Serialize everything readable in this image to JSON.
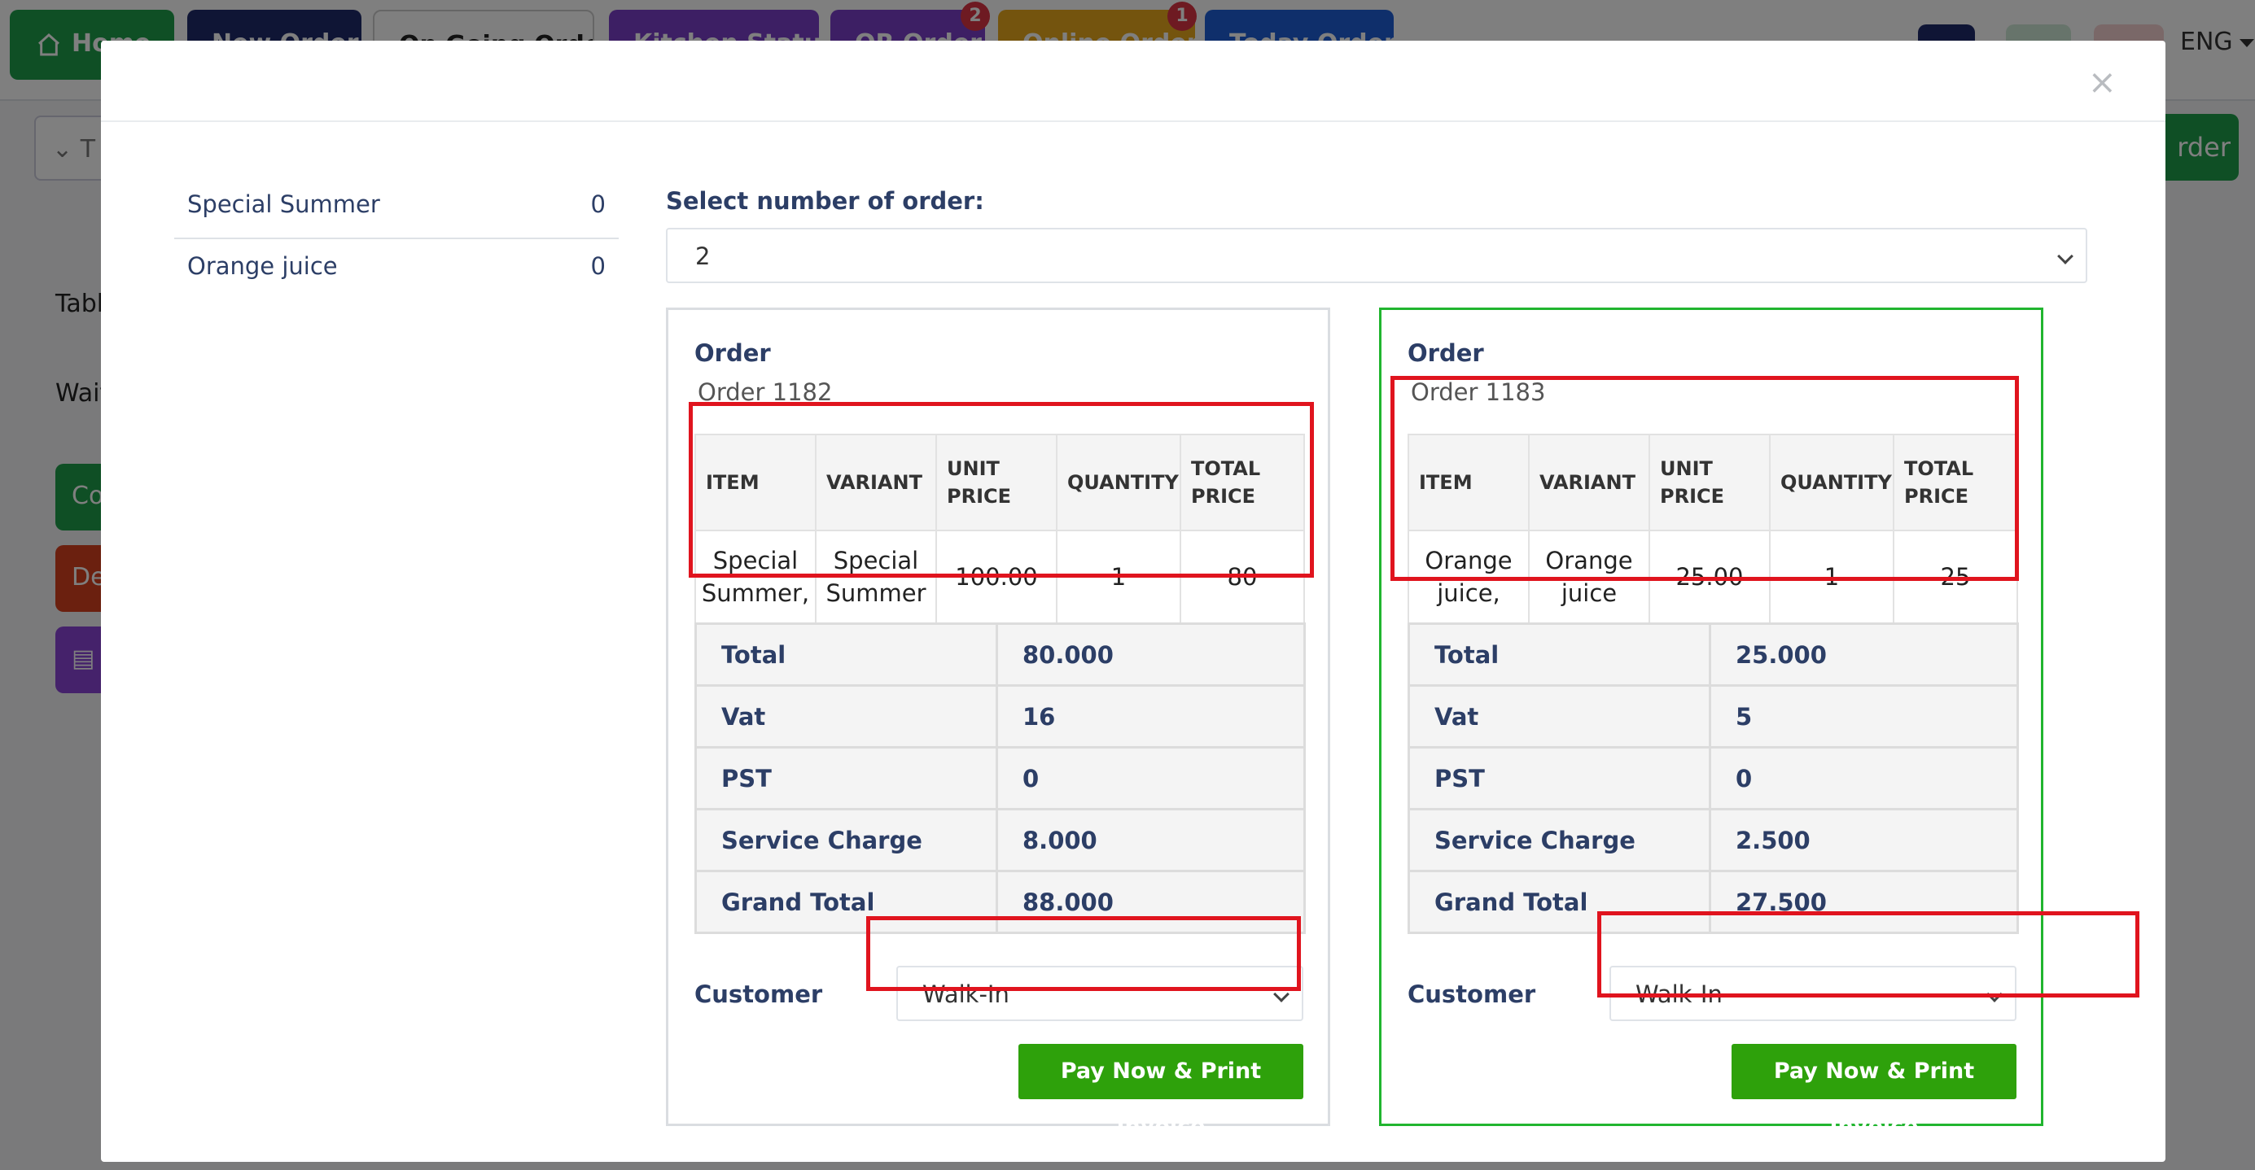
{
  "background": {
    "tabs": [
      {
        "label": "Home",
        "color": "#1e9e4a"
      },
      {
        "label": "New Order",
        "color": "#1f2a6b"
      },
      {
        "label": "On Going Order",
        "color": "#ffffff"
      },
      {
        "label": "Kitchen Status",
        "color": "#7b3fc9"
      },
      {
        "label": "QR Order",
        "color": "#7b3fc9",
        "badge": "2"
      },
      {
        "label": "Online Order",
        "color": "#e8a81c",
        "badge": "1"
      },
      {
        "label": "Today Order",
        "color": "#1e5fd6"
      }
    ],
    "language": "ENG",
    "labels": [
      "Table",
      "Waiter"
    ],
    "side_buttons": [
      {
        "label": "Co",
        "color": "#1e9e4a"
      },
      {
        "label": "De",
        "color": "#d6401f"
      },
      {
        "label": "",
        "color": "#8a44d6"
      }
    ],
    "order_button": "rder",
    "select_fragment": "T"
  },
  "modal": {
    "close_symbol": "×",
    "items": [
      {
        "name": "Special Summer",
        "count": "0"
      },
      {
        "name": "Orange juice",
        "count": "0"
      }
    ],
    "select_label": "Select number of order:",
    "select_value": "2",
    "orders": [
      {
        "title": "Order",
        "subtitle": "Order 1182",
        "columns": [
          "ITEM",
          "VARIANT",
          "UNIT PRICE",
          "QUANTITY",
          "TOTAL PRICE"
        ],
        "rows": [
          {
            "item": "Special Summer,",
            "variant": "Special Summer",
            "unit_price": "100.00",
            "quantity": "1",
            "total_price": "80"
          }
        ],
        "totals": [
          {
            "label": "Total",
            "value": "80.000"
          },
          {
            "label": "Vat",
            "value": "16"
          },
          {
            "label": "PST",
            "value": "0"
          },
          {
            "label": "Service Charge",
            "value": "8.000"
          },
          {
            "label": "Grand Total",
            "value": "88.000"
          }
        ],
        "customer_label": "Customer",
        "customer_value": "Walk-In",
        "pay_button": "Pay Now & Print Invoice"
      },
      {
        "title": "Order",
        "subtitle": "Order 1183",
        "columns": [
          "ITEM",
          "VARIANT",
          "UNIT PRICE",
          "QUANTITY",
          "TOTAL PRICE"
        ],
        "rows": [
          {
            "item": "Orange juice,",
            "variant": "Orange juice",
            "unit_price": "25.00",
            "quantity": "1",
            "total_price": "25"
          }
        ],
        "totals": [
          {
            "label": "Total",
            "value": "25.000"
          },
          {
            "label": "Vat",
            "value": "5"
          },
          {
            "label": "PST",
            "value": "0"
          },
          {
            "label": "Service Charge",
            "value": "2.500"
          },
          {
            "label": "Grand Total",
            "value": "27.500"
          }
        ],
        "customer_label": "Customer",
        "customer_value": "Walk-In",
        "pay_button": "Pay Now & Print Invoice"
      }
    ]
  },
  "colors": {
    "accent_green": "#2ea10b",
    "selected_border": "#21b52f",
    "annotation_red": "#e0141e",
    "heading_navy": "#2c3e66"
  }
}
